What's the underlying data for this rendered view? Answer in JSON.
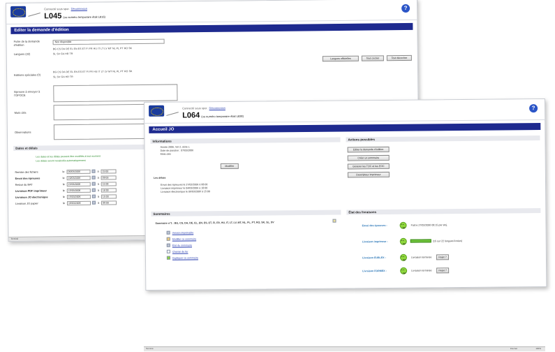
{
  "win1": {
    "connected": "Connecté sous spor.",
    "logout": "Déconnexion",
    "code": "L045",
    "code_note": "(ou numéro temporaire était L816)",
    "title": "Editer la demande d'édition",
    "fiche_label": "Fiche de la demande d'édition",
    "fiche_value": "Non disponible",
    "langues_label": "Langues (22)",
    "flags_row1": "BG CS DA DE EL EN ES ET FI FR HU IT LT LV MT NL PL PT RO SK",
    "flags_row2": "SL SV GA HR TR",
    "btn_officielles": "Langues officielles",
    "btn_cocher": "Tout cocher",
    "btn_decocher": "Tout décocher",
    "editions_label": "Editions spéciales (0)",
    "epreuve_label": "Epreuve à envoyer à l'OPOCE",
    "mots_label": "Mots clés",
    "obs_label": "Observations",
    "dates_title": "Dates et délais",
    "hint1": "Les dates et les délais peuvent être modifiés à tout moment",
    "hint2": "Les délais seront recalculés automatiquement",
    "dates": [
      {
        "label": "Remise des fichiers",
        "date": "06/03/2006",
        "time": "15:00",
        "bold": false
      },
      {
        "label": "Envoi des épreuves",
        "date": "10/03/2006",
        "time": "09:00",
        "bold": true
      },
      {
        "label": "Retour du BAT",
        "date": "15/03/2006",
        "time": "15:00",
        "bold": false
      },
      {
        "label": "Livraison PDF imprimeur",
        "date": "15/03/2006",
        "time": "18:00",
        "bold": true
      },
      {
        "label": "Livraison JO électronique",
        "date": "15/03/2006",
        "time": "15:00",
        "bold": true
      },
      {
        "label": "Livraison JO papier",
        "date": "16/03/2006",
        "time": "09:00",
        "bold": false
      }
    ],
    "le": "le",
    "a": "à",
    "status": "Terminé"
  },
  "win2": {
    "connected": "Connecté sous spor.",
    "logout": "Déconnexion",
    "code": "L064",
    "code_note": "(ou numéro temporaire était L828)",
    "title": "Accueil JO",
    "info_title": "Informations",
    "info_items": [
      "Année 2006, Vol 2, série L",
      "Date de parution : 07/03/2006",
      "Mots clés"
    ],
    "btn_modifier": "Modifier",
    "delais_title": "Les délais",
    "delais_items": [
      "Envoi des épreuves le 27/02/2006 à 08:00",
      "Livraison imprimeur le 04/03/2006 à 18:00",
      "Livraison électronique le 06/03/2006 à 15:00"
    ],
    "actions_title": "Actions possibles",
    "actions": [
      "Editer la demande d'édition",
      "Créer un sommaire",
      "Générer les TOC et les EOC",
      "Descripteur imprimeur"
    ],
    "sommaires_title": "Sommaires",
    "sommaire_line": "Sommaire n°1 : BG, CS, DA, DE, EL, EN, ES, ET, FI, FR, HU, IT, LT, LV, MT, NL, PL, PT, RO, SK, SL, SV",
    "sommaire_links": [
      "Version imprimable",
      "Modifier ce sommaire",
      "État du sommaire",
      "Chemin de fer",
      "Dupliquer ce sommaire"
    ],
    "etat_title": "État des livraisons",
    "livraisons": [
      {
        "label": "Envoi des épreuves :",
        "text": "Fait le 27/02/2006 08:15 par stoj."
      },
      {
        "label": "Livraison imprimeur :",
        "text": "(15 sur 22 langues livrées)"
      },
      {
        "label": "Livraison EURLEX :",
        "text": "Livraison terminée",
        "btn": "Rejet ?"
      },
      {
        "label": "Livraison FORMEX :",
        "text": "Livraison terminée",
        "btn": "Rejet ?"
      }
    ],
    "progress": 0.68,
    "status": "Terminé",
    "ie_zone": "Internet",
    "ie_zoom": "100%"
  }
}
